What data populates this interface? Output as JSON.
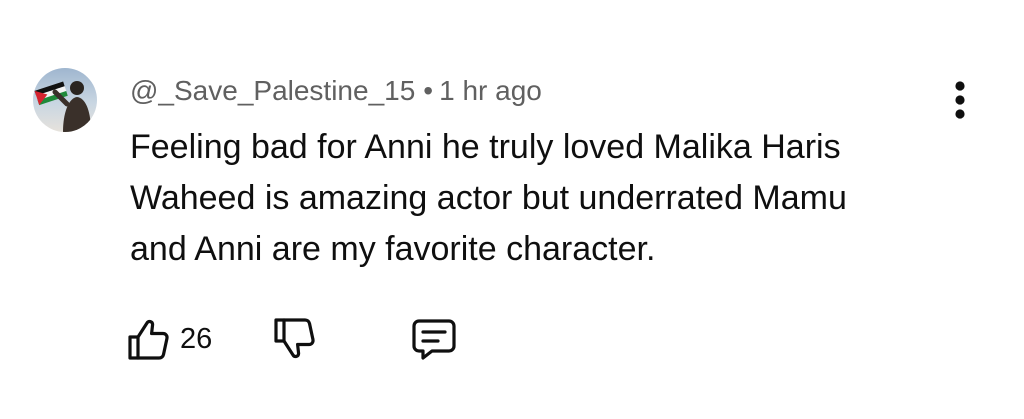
{
  "comment": {
    "author": "@_Save_Palestine_15",
    "separator": "•",
    "time": "1 hr ago",
    "text_lines": [
      "Feeling bad for Anni he truly loved Malika Haris",
      "Waheed is amazing actor but underrated Mamu",
      "and Anni are my favorite character."
    ],
    "like_count": "26"
  },
  "icons": {
    "like": "thumbs-up-icon",
    "dislike": "thumbs-down-icon",
    "reply": "reply-comment-icon",
    "menu": "more-vertical-icon"
  },
  "colors": {
    "text": "#0f0f0f",
    "meta": "#606060"
  }
}
